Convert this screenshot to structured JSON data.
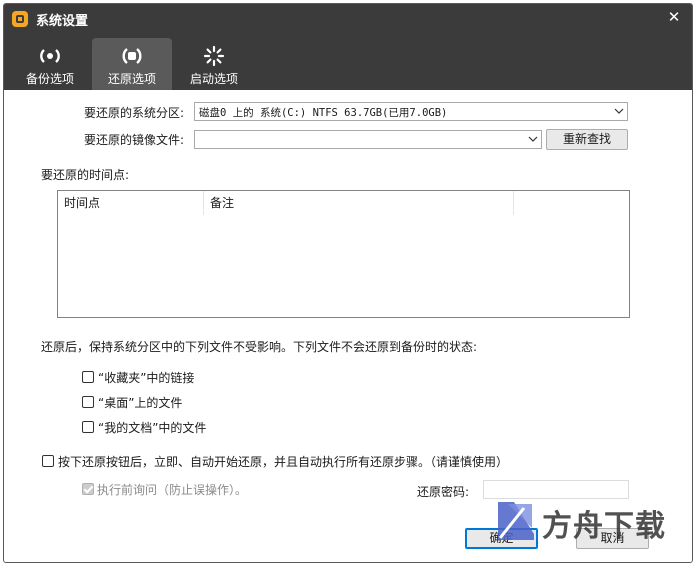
{
  "window": {
    "title": "系统设置",
    "close_glyph": "✕"
  },
  "tabs": [
    {
      "label": "备份选项",
      "icon": "backup-icon"
    },
    {
      "label": "还原选项",
      "icon": "restore-icon",
      "active": true
    },
    {
      "label": "启动选项",
      "icon": "startup-icon"
    }
  ],
  "form": {
    "partition_label": "要还原的系统分区:",
    "partition_value": "磁盘0 上的 系统(C:) NTFS 63.7GB(已用7.0GB)",
    "image_label": "要还原的镜像文件:",
    "image_value": "",
    "rescan_button": "重新查找",
    "timepoint_label": "要还原的时间点:",
    "columns": [
      "时间点",
      "备注"
    ],
    "keep_files_label": "还原后，保持系统分区中的下列文件不受影响。下列文件不会还原到备份时的状态:",
    "keep_items": [
      {
        "label": "“收藏夹”中的链接",
        "checked": false
      },
      {
        "label": "“桌面”上的文件",
        "checked": false
      },
      {
        "label": "“我的文档”中的文件",
        "checked": false
      }
    ],
    "auto_restore_label": "按下还原按钮后，立即、自动开始还原，并且自动执行所有还原步骤。（请谨慎使用）",
    "confirm_before_label": "执行前询问（防止误操作）。",
    "password_label": "还原密码:",
    "password_value": ""
  },
  "buttons": {
    "ok": "确定",
    "cancel": "取消"
  },
  "watermark": {
    "text": "方舟下载"
  }
}
